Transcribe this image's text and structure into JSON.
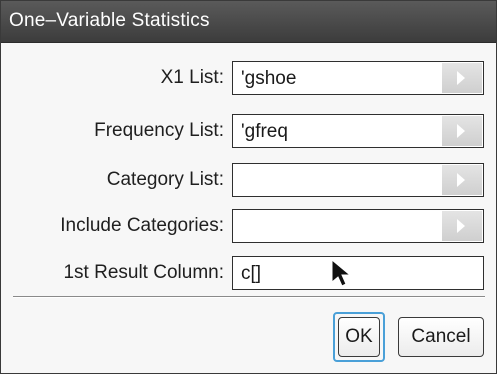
{
  "dialog": {
    "title": "One–Variable Statistics"
  },
  "fields": [
    {
      "label": "X1 List:",
      "value": "'gshoe",
      "has_dropdown": true
    },
    {
      "label": "Frequency List:",
      "value": "'gfreq",
      "has_dropdown": true
    },
    {
      "label": "Category List:",
      "value": "",
      "has_dropdown": true
    },
    {
      "label": "Include Categories:",
      "value": "",
      "has_dropdown": true
    },
    {
      "label": "1st Result Column:",
      "value": "c[]",
      "has_dropdown": false
    }
  ],
  "buttons": {
    "ok_label": "OK",
    "cancel_label": "Cancel"
  },
  "icons": {
    "dropdown": "triangle-right-icon",
    "pointer": "mouse-pointer-icon"
  },
  "colors": {
    "titlebar": "#474747",
    "focus_ring": "#4aa0d8",
    "dropdown_button": "#d8d8d8",
    "dropdown_arrow": "#ffffff"
  }
}
